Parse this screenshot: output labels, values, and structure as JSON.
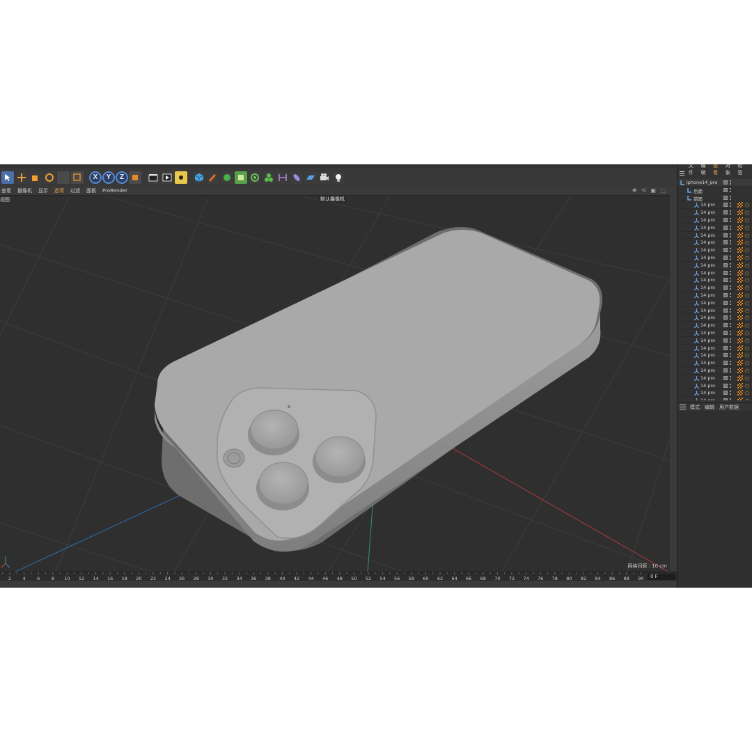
{
  "toolbar": {
    "icons": [
      "select-icon",
      "move-icon",
      "scale-icon",
      "rotate-icon",
      "object-tool-icon",
      "render-region-icon"
    ],
    "axes": [
      "X",
      "Y",
      "Z"
    ],
    "render_icons": [
      "clapboard-icon",
      "render-view-icon",
      "render-settings-icon"
    ],
    "object_icons": [
      "cube-icon",
      "spline-pen-icon",
      "generator-icon",
      "deformer-icon",
      "scene-icon",
      "mograph-icon",
      "measure-icon",
      "capsule-icon",
      "floor-icon",
      "camera-icon",
      "light-icon"
    ]
  },
  "viewmenu": {
    "items": [
      "查看",
      "摄像机",
      "显示",
      "选项",
      "过滤",
      "面板",
      "ProRender"
    ],
    "active_index": 3
  },
  "viewport": {
    "label": "视图",
    "camera": "默认摄像机",
    "grid_info": "网格间距 : 10 cm"
  },
  "timeline": {
    "ticks": [
      2,
      4,
      6,
      8,
      10,
      12,
      14,
      16,
      18,
      20,
      22,
      24,
      26,
      28,
      30,
      32,
      34,
      36,
      38,
      40,
      42,
      44,
      46,
      48,
      50,
      52,
      54,
      56,
      58,
      60,
      62,
      64,
      66,
      68,
      70,
      72,
      74,
      76,
      78,
      80,
      82,
      84,
      86,
      88,
      90
    ],
    "frame": "0 F"
  },
  "objects_panel": {
    "menu": [
      "文件",
      "编辑",
      "查看",
      "对象",
      "标签"
    ],
    "active_index": 2,
    "root": "iphone14_pro",
    "groups": [
      "后面",
      "前面"
    ],
    "child_name": "14 pro",
    "child_count": 27
  },
  "attributes_panel": {
    "menu": [
      "模式",
      "编辑",
      "用户数据"
    ]
  },
  "colors": {
    "background": "#2f2f2f",
    "accent": "#e7a64a",
    "phone_body": "#a9a9a9",
    "axis_x": "#d04040",
    "axis_y": "#3cb06a",
    "axis_z": "#3a7fd0"
  }
}
